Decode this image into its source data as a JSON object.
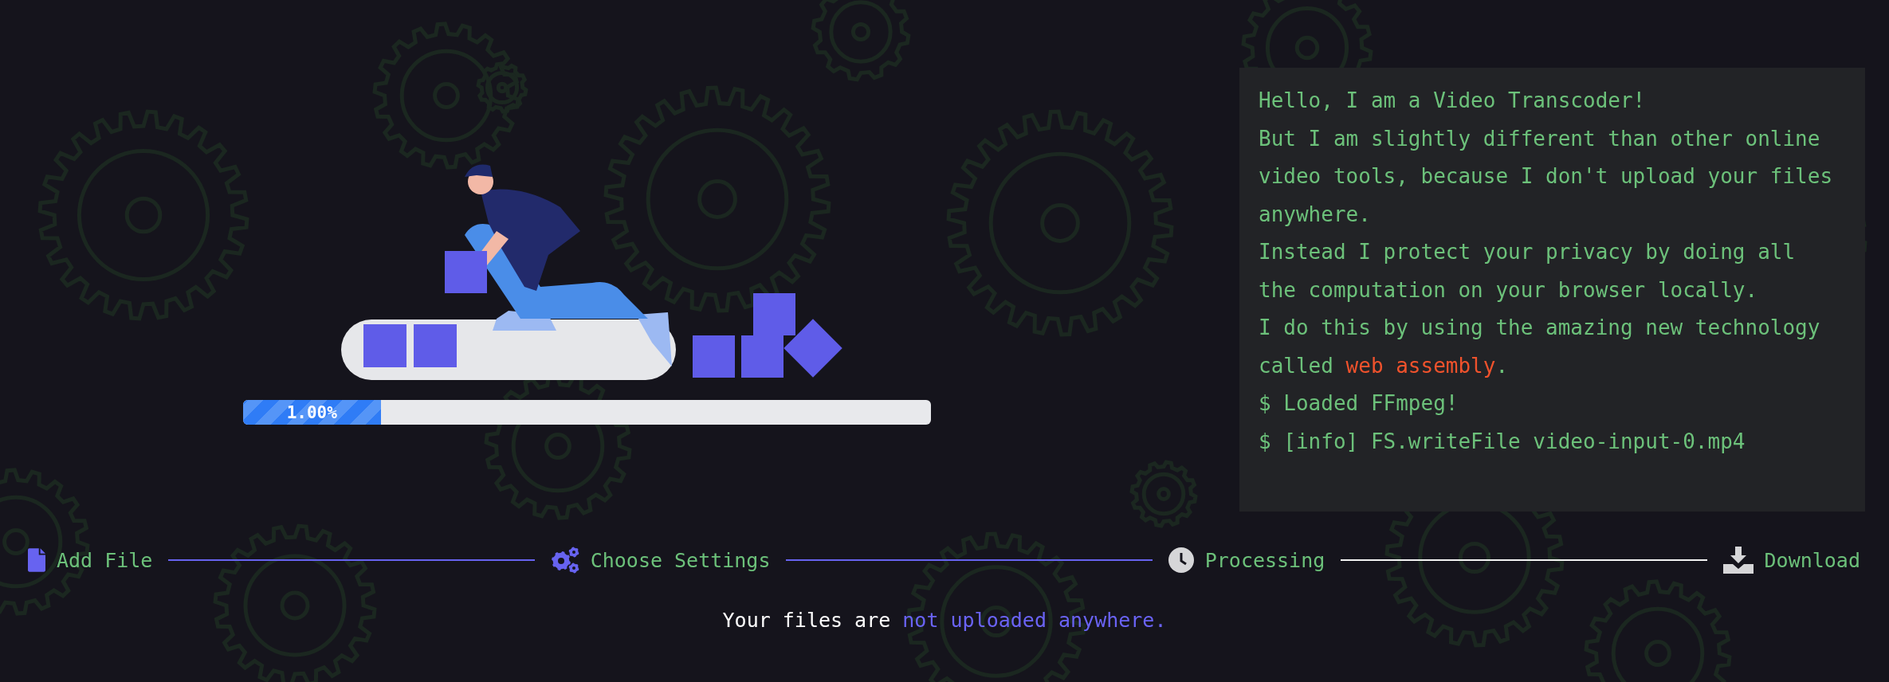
{
  "progress": {
    "label": "1.00%",
    "level": 0.2
  },
  "console": {
    "messages": [
      {
        "segments": [
          {
            "text": "Hello, I am a Video Transcoder!",
            "kind": "plain"
          }
        ]
      },
      {
        "segments": [
          {
            "text": "But I am slightly different than other online video tools, because I don't upload your files anywhere.",
            "kind": "plain"
          }
        ]
      },
      {
        "segments": [
          {
            "text": "Instead I protect your privacy by doing all the computation on your browser locally.",
            "kind": "plain"
          }
        ]
      },
      {
        "segments": [
          {
            "text": "I do this by using the amazing new technology called ",
            "kind": "plain"
          },
          {
            "text": "web assembly",
            "kind": "highlight"
          },
          {
            "text": ".",
            "kind": "plain"
          }
        ]
      },
      {
        "segments": [
          {
            "text": "$ Loaded FFmpeg!",
            "kind": "plain"
          }
        ]
      },
      {
        "segments": [
          {
            "text": "$ [info] FS.writeFile video-input-0.mp4",
            "kind": "plain"
          }
        ]
      }
    ]
  },
  "steps": [
    {
      "label": "Add File",
      "kind": "file",
      "completed": true
    },
    {
      "label": "Choose Settings",
      "kind": "settings",
      "completed": true
    },
    {
      "label": "Processing",
      "kind": "clock",
      "completed": false
    },
    {
      "label": "Download",
      "kind": "download",
      "completed": false
    }
  ],
  "footer": {
    "segments": [
      {
        "text": "Your files are ",
        "kind": "plain"
      },
      {
        "text": "not uploaded anywhere.",
        "kind": "highlight"
      }
    ]
  }
}
